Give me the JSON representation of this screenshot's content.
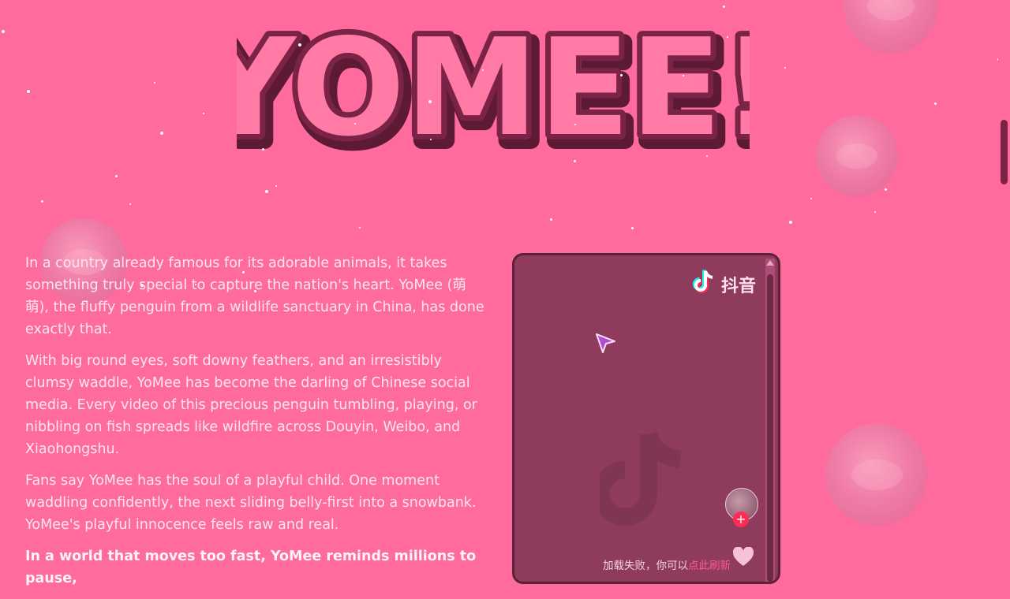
{
  "hero": {
    "title": "YOMEE!",
    "colors": {
      "fill": "#ff6f9c",
      "outline": "#7a2346",
      "shadow": "#5c1a34"
    }
  },
  "story": {
    "paragraphs": [
      "In a country already famous for its adorable animals, it takes something truly special to capture the nation's heart. YoMee (萌萌), the fluffy penguin from a wildlife sanctuary in China, has done exactly that.",
      "With big round eyes, soft downy feathers, and an irresistibly clumsy waddle, YoMee has become the darling of Chinese social media. Every video of this precious penguin tumbling, playing, or nibbling on fish spreads like wildfire across Douyin, Weibo, and Xiaohongshu.",
      "Fans say YoMee has the soul of a playful child. One moment waddling confidently, the next sliding belly-first into a snowbank. YoMee's playful innocence feels raw and real."
    ],
    "highlight": "In a world that moves too fast, YoMee reminds millions to pause,"
  },
  "douyin_embed": {
    "brand_name": "抖音",
    "load_failed_text": "加载失败，你可以",
    "refresh_link": "点此刷新",
    "follow_symbol": "+",
    "icons": [
      "douyin-logo-icon",
      "cursor-arrow-icon",
      "douyin-watermark-icon",
      "heart-icon"
    ]
  },
  "colors": {
    "background": "#ff6b9d",
    "text": "#fde6ef",
    "embed_bg": "#8e3b5d",
    "accent": "#fe2c55"
  }
}
